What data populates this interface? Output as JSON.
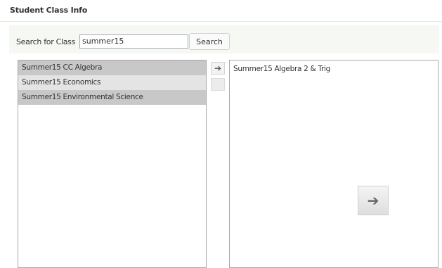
{
  "header": {
    "title": "Student Class Info"
  },
  "search": {
    "label": "Search for Class",
    "value": "summer15",
    "button_label": "Search"
  },
  "available_classes": [
    {
      "label": "Summer15 CC Algebra",
      "selected": true
    },
    {
      "label": "Summer15 Economics",
      "selected": false
    },
    {
      "label": "Summer15 Environmental Science",
      "selected": true
    }
  ],
  "selected_classes": [
    {
      "label": "Summer15 Algebra 2 & Trig"
    }
  ],
  "icons": {
    "move_right": "arrow-right-icon",
    "move_left": "arrow-left-icon",
    "big_arrow": "arrow-right-icon"
  },
  "colors": {
    "selected_row": "#c8c8c8",
    "unselected_row": "#e4e4e4",
    "panel_background": "#f6f8f3"
  }
}
